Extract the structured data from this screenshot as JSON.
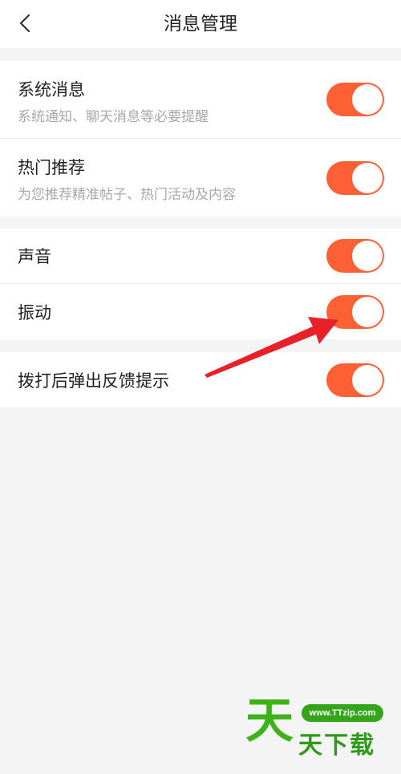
{
  "header": {
    "title": "消息管理"
  },
  "groups": [
    {
      "rows": [
        {
          "title": "系统消息",
          "subtitle": "系统通知、聊天消息等必要提醒",
          "enabled": true
        },
        {
          "title": "热门推荐",
          "subtitle": "为您推荐精准帖子、热门活动及内容",
          "enabled": true
        }
      ]
    },
    {
      "rows": [
        {
          "title": "声音",
          "enabled": true
        },
        {
          "title": "振动",
          "enabled": true
        }
      ]
    },
    {
      "rows": [
        {
          "title": "拨打后弹出反馈提示",
          "enabled": true
        }
      ]
    }
  ],
  "colors": {
    "accent": "#fe6035",
    "annotation_arrow": "#e8202a",
    "watermark_green": "#3fb21b"
  },
  "icons": {
    "back": "chevron-left-icon"
  },
  "watermark": {
    "url": "www.TTzip.com",
    "big_char": "天",
    "text": "天下载"
  }
}
